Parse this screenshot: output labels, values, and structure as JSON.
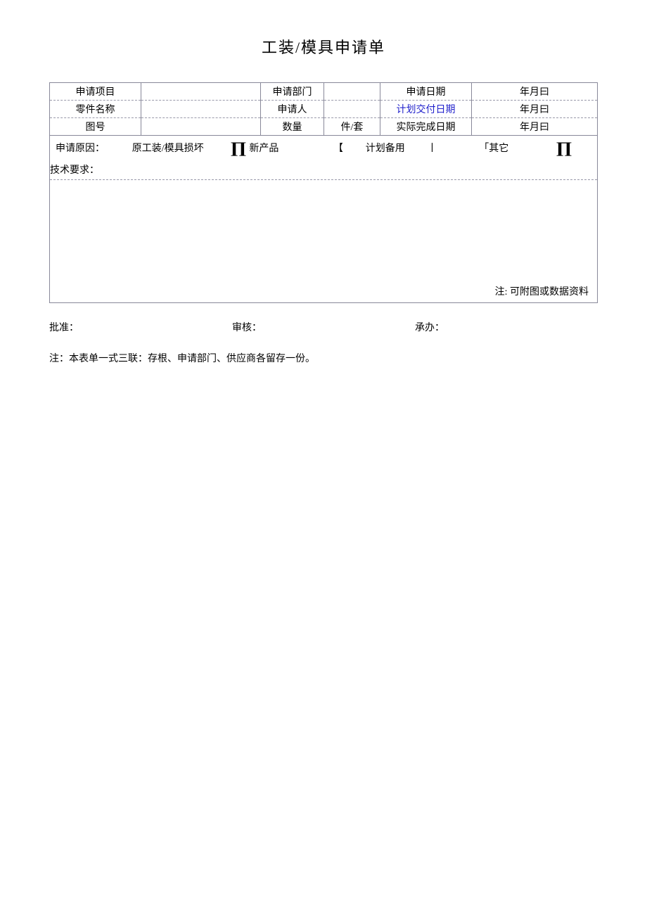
{
  "title": "工装/模具申请单",
  "header": {
    "project_label": "申请项目",
    "project_value": "",
    "dept_label": "申请部门",
    "dept_value": "",
    "date_label": "申请日期",
    "date_value": "年月曰",
    "part_label": "零件名称",
    "part_value": "",
    "applicant_label": "申请人",
    "applicant_value": "",
    "plan_date_label": "计划交付日期",
    "plan_date_value": "年月曰",
    "drawing_label": "图号",
    "drawing_value": "",
    "qty_label": "数量",
    "qty_value": "件/套",
    "actual_date_label": "实际完成日期",
    "actual_date_value": "年月曰"
  },
  "reason": {
    "label": "申请原因：",
    "opt1": "原工装/模具损坏",
    "opt1_mark_left": "",
    "opt1_mark_right": "∏",
    "opt2": "新产品",
    "opt2_bracket_left": "【",
    "opt3": "计划备用",
    "opt3_bracket_right": "丨",
    "opt4_bracket_left": "「",
    "opt4": "其它",
    "opt4_mark": "∏"
  },
  "tech": {
    "label": "技术要求：",
    "note": "注: 可附图或数据资料"
  },
  "signatures": {
    "approve": "批准：",
    "review": "审核：",
    "handle": "承办："
  },
  "footnote": "注：本表单一式三联：存根、申请部门、供应商各留存一份。"
}
